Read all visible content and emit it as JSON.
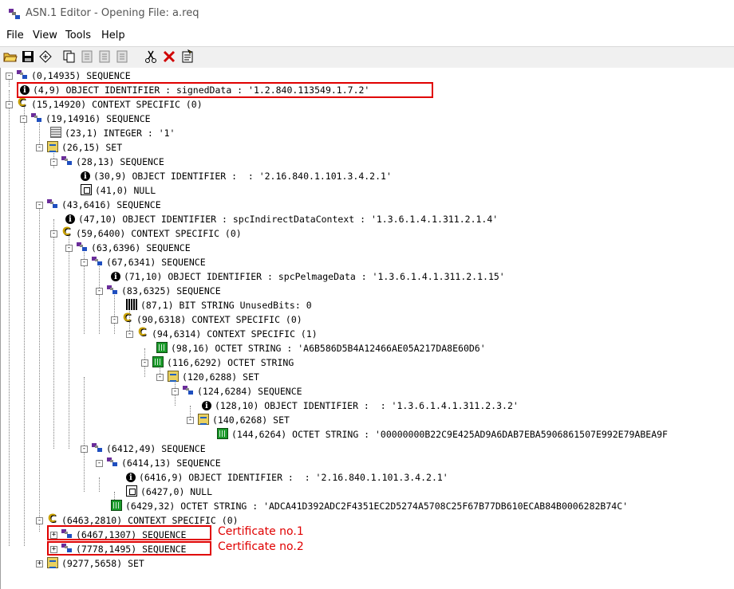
{
  "window": {
    "title": "ASN.1 Editor - Opening File: a.req"
  },
  "menu": [
    "File",
    "View",
    "Tools",
    "Help"
  ],
  "toolbar_icons": [
    "open-folder-icon",
    "save-icon",
    "diamond-icon",
    "copy-icon",
    "paste-icon",
    "paste-before-icon",
    "paste-after-icon",
    "cut-icon",
    "delete-icon",
    "edit-icon"
  ],
  "tree": [
    {
      "text": "(0,14935) SEQUENCE",
      "icon": "seq"
    },
    {
      "text": "(4,9) OBJECT IDENTIFIER : signedData : '1.2.840.113549.1.7.2'",
      "icon": "oid"
    },
    {
      "text": "(15,14920) CONTEXT SPECIFIC (0)",
      "icon": "ctx"
    },
    {
      "text": "(19,14916) SEQUENCE",
      "icon": "seq"
    },
    {
      "text": "(23,1) INTEGER : '1'",
      "icon": "int"
    },
    {
      "text": "(26,15) SET",
      "icon": "set"
    },
    {
      "text": "(28,13) SEQUENCE",
      "icon": "seq"
    },
    {
      "text": "(30,9) OBJECT IDENTIFIER :  : '2.16.840.1.101.3.4.2.1'",
      "icon": "oid"
    },
    {
      "text": "(41,0) NULL",
      "icon": "null"
    },
    {
      "text": "(43,6416) SEQUENCE",
      "icon": "seq"
    },
    {
      "text": "(47,10) OBJECT IDENTIFIER : spcIndirectDataContext : '1.3.6.1.4.1.311.2.1.4'",
      "icon": "oid"
    },
    {
      "text": "(59,6400) CONTEXT SPECIFIC (0)",
      "icon": "ctx"
    },
    {
      "text": "(63,6396) SEQUENCE",
      "icon": "seq"
    },
    {
      "text": "(67,6341) SEQUENCE",
      "icon": "seq"
    },
    {
      "text": "(71,10) OBJECT IDENTIFIER : spcPelmageData : '1.3.6.1.4.1.311.2.1.15'",
      "icon": "oid"
    },
    {
      "text": "(83,6325) SEQUENCE",
      "icon": "seq"
    },
    {
      "text": "(87,1) BIT STRING UnusedBits: 0",
      "icon": "bit"
    },
    {
      "text": "(90,6318) CONTEXT SPECIFIC (0)",
      "icon": "ctx"
    },
    {
      "text": "(94,6314) CONTEXT SPECIFIC (1)",
      "icon": "ctx"
    },
    {
      "text": "(98,16) OCTET STRING : 'A6B586D5B4A12466AE05A217DA8E60D6'",
      "icon": "oct"
    },
    {
      "text": "(116,6292) OCTET STRING",
      "icon": "oct"
    },
    {
      "text": "(120,6288) SET",
      "icon": "set"
    },
    {
      "text": "(124,6284) SEQUENCE",
      "icon": "seq"
    },
    {
      "text": "(128,10) OBJECT IDENTIFIER :  : '1.3.6.1.4.1.311.2.3.2'",
      "icon": "oid"
    },
    {
      "text": "(140,6268) SET",
      "icon": "set"
    },
    {
      "text": "(144,6264) OCTET STRING : '00000000B22C9E425AD9A6DAB7EBA5906861507E992E79ABEA9F",
      "icon": "oct"
    },
    {
      "text": "(6412,49) SEQUENCE",
      "icon": "seq"
    },
    {
      "text": "(6414,13) SEQUENCE",
      "icon": "seq"
    },
    {
      "text": "(6416,9) OBJECT IDENTIFIER :  : '2.16.840.1.101.3.4.2.1'",
      "icon": "oid"
    },
    {
      "text": "(6427,0) NULL",
      "icon": "null"
    },
    {
      "text": "(6429,32) OCTET STRING : 'ADCA41D392ADC2F4351EC2D5274A5708C25F67B77DB610ECAB84B0006282B74C'",
      "icon": "oct"
    },
    {
      "text": "(6463,2810) CONTEXT SPECIFIC (0)",
      "icon": "ctx"
    },
    {
      "text": "(6467,1307) SEQUENCE",
      "icon": "seq"
    },
    {
      "text": "(7778,1495) SEQUENCE",
      "icon": "seq"
    },
    {
      "text": "(9277,5658) SET",
      "icon": "set"
    }
  ],
  "annotations": {
    "cert1": "Certificate no.1",
    "cert2": "Certificate no.2"
  },
  "colors": {
    "highlight": "#e00000"
  }
}
